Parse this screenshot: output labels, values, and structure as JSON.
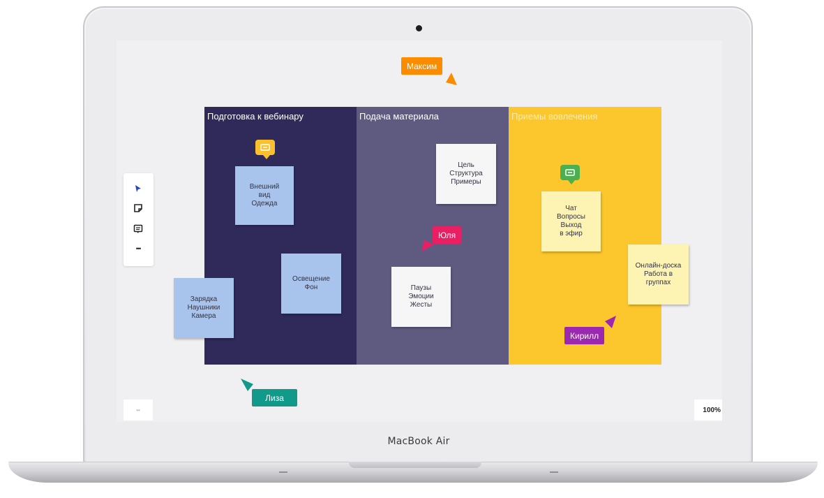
{
  "device": {
    "brand_label": "MacBook Air"
  },
  "toolbar": {
    "tools": [
      {
        "icon": "cursor-icon",
        "color": "#2446c8"
      },
      {
        "icon": "sticky-note-icon",
        "color": "#222222"
      },
      {
        "icon": "comment-icon",
        "color": "#222222"
      },
      {
        "icon": "more-icon",
        "label": "•••"
      }
    ]
  },
  "board": {
    "columns": [
      {
        "title": "Подготовка к вебинару",
        "color": "#2f2a5a"
      },
      {
        "title": "Подача материала",
        "color": "#5f5a80"
      },
      {
        "title": "Приемы вовлечения",
        "color": "#fcc72c"
      }
    ],
    "stickies": [
      {
        "text": "Внешний\nвид\nОдежда",
        "color": "#a9c4ec"
      },
      {
        "text": "Освещение\nФон",
        "color": "#a9c4ec"
      },
      {
        "text": "Зарядка\nНаушники\nКамера",
        "color": "#a9c4ec"
      },
      {
        "text": "Цель\nСтруктура\nПримеры",
        "color": "#f6f6f6"
      },
      {
        "text": "Паузы\nЭмоции\nЖесты",
        "color": "#f6f6f6"
      },
      {
        "text": "Чат\nВопросы\nВыход\nв эфир",
        "color": "#fdf3b2"
      },
      {
        "text": "Онлайн-доска\nРабота в\nгруппах",
        "color": "#fdf3b2"
      }
    ],
    "comments": [
      {
        "icon": "comment-icon",
        "color": "#fbc02d"
      },
      {
        "icon": "comment-icon",
        "color": "#4caf50"
      }
    ]
  },
  "cursors": [
    {
      "name": "Максим",
      "color": "#fb8c00"
    },
    {
      "name": "Юля",
      "color": "#e91e63"
    },
    {
      "name": "Кирилл",
      "color": "#9c27b0"
    },
    {
      "name": "Лиза",
      "color": "#11998a"
    }
  ],
  "footer": {
    "minimap_label": "••",
    "zoom": "100%"
  }
}
